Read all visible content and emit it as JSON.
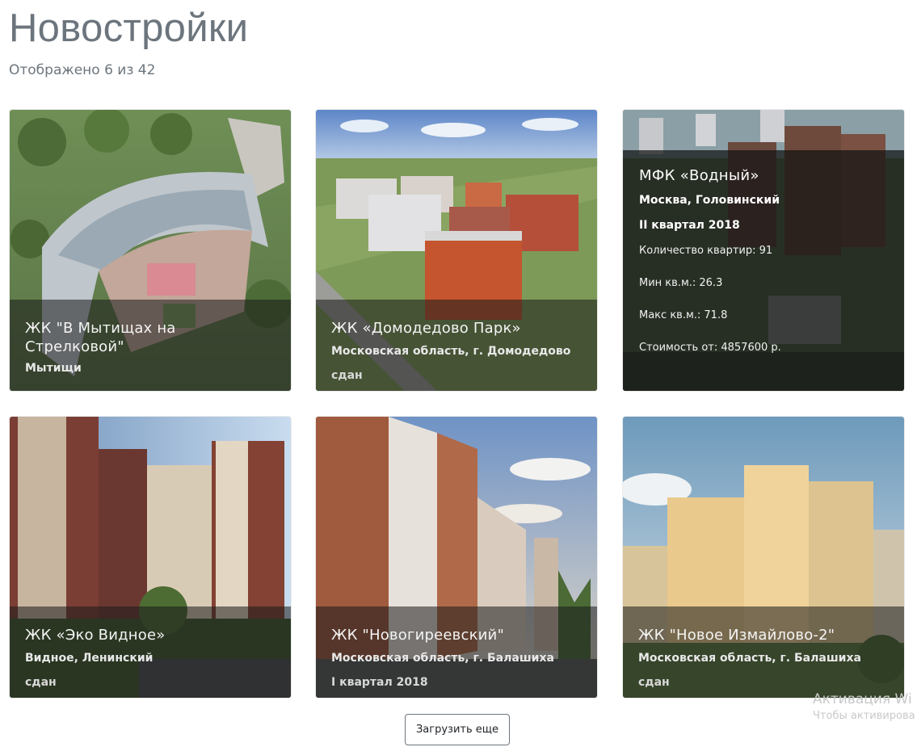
{
  "header": {
    "title": "Новостройки",
    "counter": "Отображено 6 из 42"
  },
  "cards": [
    {
      "title": "ЖК \"В Мытищах на Стрелковой\"",
      "place": "Мытищи",
      "status": ""
    },
    {
      "title": "ЖК «Домодедово Парк»",
      "place": "Московская область, г. Домодедово",
      "status": "сдан"
    },
    {
      "title": "МФК «Водный»",
      "place": "Москва, Головинский",
      "quarter": "II квартал 2018",
      "apartments": "Количество квартир: 91",
      "min_area": "Мин кв.м.: 26.3",
      "max_area": "Макс кв.м.: 71.8",
      "price": "Стоимость от: 4857600 р."
    },
    {
      "title": "ЖК «Эко Видное»",
      "place": "Видное, Ленинский",
      "status": "сдан"
    },
    {
      "title": "ЖК \"Новогиреевский\"",
      "place": "Московская область, г. Балашиха",
      "status": "I квартал 2018"
    },
    {
      "title": "ЖК \"Новое Измайлово-2\"",
      "place": "Московская область, г. Балашиха",
      "status": "сдан"
    }
  ],
  "load_more": {
    "label": "Загрузить еще"
  },
  "watermark": {
    "line1": "Активация Wi",
    "line2": "Чтобы активирова"
  }
}
